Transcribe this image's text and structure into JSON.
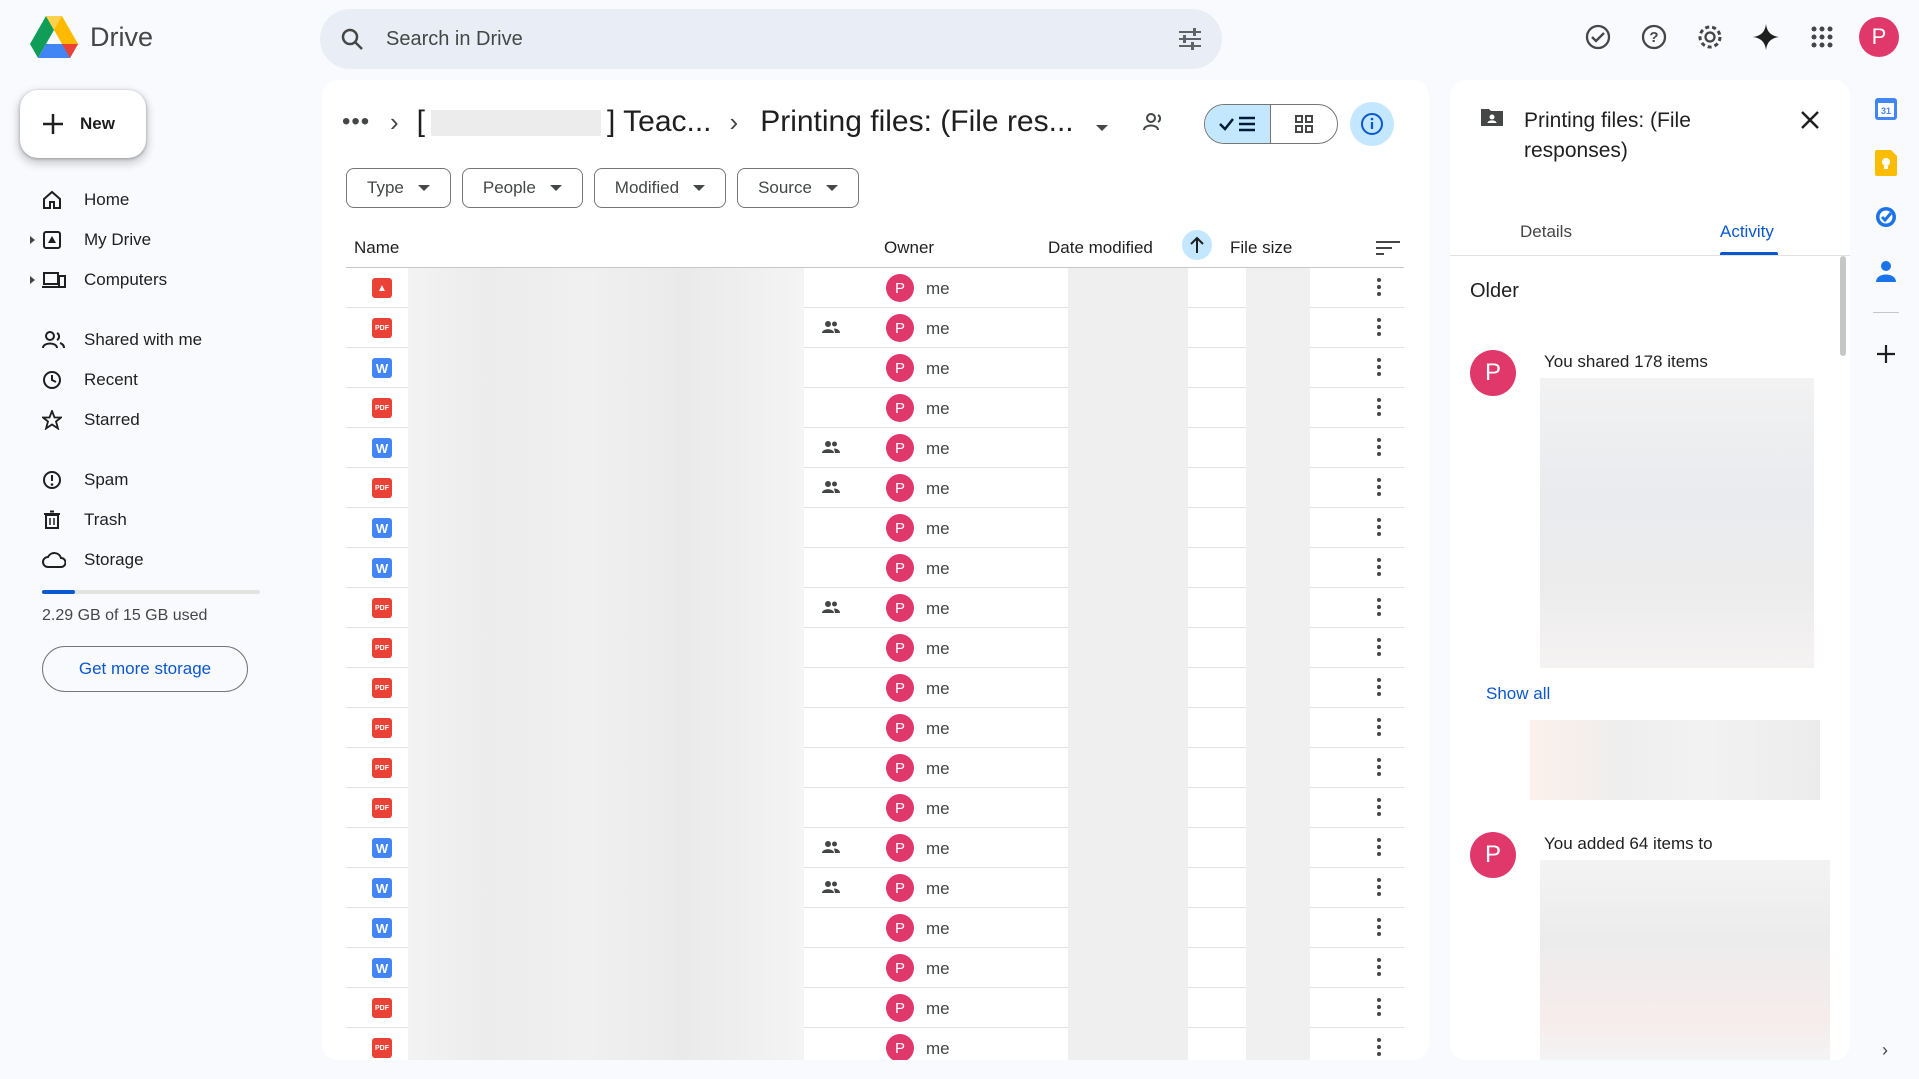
{
  "app": {
    "name": "Drive"
  },
  "search": {
    "placeholder": "Search in Drive"
  },
  "user": {
    "initial": "P"
  },
  "left_nav": {
    "new_label": "New",
    "items": [
      {
        "label": "Home",
        "icon": "home-icon"
      },
      {
        "label": "My Drive",
        "icon": "my-drive-icon"
      },
      {
        "label": "Computers",
        "icon": "computers-icon"
      },
      {
        "label": "Shared with me",
        "icon": "shared-icon"
      },
      {
        "label": "Recent",
        "icon": "clock-icon"
      },
      {
        "label": "Starred",
        "icon": "star-icon"
      },
      {
        "label": "Spam",
        "icon": "spam-icon"
      },
      {
        "label": "Trash",
        "icon": "trash-icon"
      },
      {
        "label": "Storage",
        "icon": "cloud-icon"
      }
    ],
    "storage_used_fraction": 0.153,
    "storage_text": "2.29 GB of 15 GB used",
    "get_storage_label": "Get more storage"
  },
  "breadcrumb": {
    "dots": "•••",
    "parent_prefix": "[",
    "parent_suffix": "] Teac...",
    "current": "Printing files: (File res..."
  },
  "filters": [
    "Type",
    "People",
    "Modified",
    "Source"
  ],
  "table": {
    "columns": {
      "name": "Name",
      "owner": "Owner",
      "date_modified": "Date modified",
      "file_size": "File size"
    },
    "rows": [
      {
        "type": "img",
        "shared": false,
        "owner": "me"
      },
      {
        "type": "pdf",
        "shared": true,
        "owner": "me"
      },
      {
        "type": "doc",
        "shared": false,
        "owner": "me"
      },
      {
        "type": "pdf",
        "shared": false,
        "owner": "me"
      },
      {
        "type": "doc",
        "shared": true,
        "owner": "me"
      },
      {
        "type": "pdf",
        "shared": true,
        "owner": "me"
      },
      {
        "type": "doc",
        "shared": false,
        "owner": "me"
      },
      {
        "type": "doc",
        "shared": false,
        "owner": "me"
      },
      {
        "type": "pdf",
        "shared": true,
        "owner": "me"
      },
      {
        "type": "pdf",
        "shared": false,
        "owner": "me"
      },
      {
        "type": "pdf",
        "shared": false,
        "owner": "me"
      },
      {
        "type": "pdf",
        "shared": false,
        "owner": "me"
      },
      {
        "type": "pdf",
        "shared": false,
        "owner": "me"
      },
      {
        "type": "pdf",
        "shared": false,
        "owner": "me"
      },
      {
        "type": "doc",
        "shared": true,
        "owner": "me"
      },
      {
        "type": "doc",
        "shared": true,
        "owner": "me"
      },
      {
        "type": "doc",
        "shared": false,
        "owner": "me"
      },
      {
        "type": "doc",
        "shared": false,
        "owner": "me"
      },
      {
        "type": "pdf",
        "shared": false,
        "owner": "me"
      },
      {
        "type": "pdf",
        "shared": false,
        "owner": "me"
      }
    ]
  },
  "details_panel": {
    "title": "Printing files: (File responses)",
    "tabs": [
      "Details",
      "Activity"
    ],
    "active_tab": "Activity",
    "section": "Older",
    "activities": [
      {
        "avatar": "P",
        "text": "You shared 178 items"
      },
      {
        "avatar": "P",
        "text": "You added 64 items to"
      }
    ],
    "show_all": "Show all"
  },
  "file_type_labels": {
    "pdf": "PDF",
    "doc": "W",
    "img": "▲"
  },
  "colors": {
    "accent": "#0b57d0",
    "avatar": "#e0386b",
    "selected": "#c2e7ff"
  }
}
